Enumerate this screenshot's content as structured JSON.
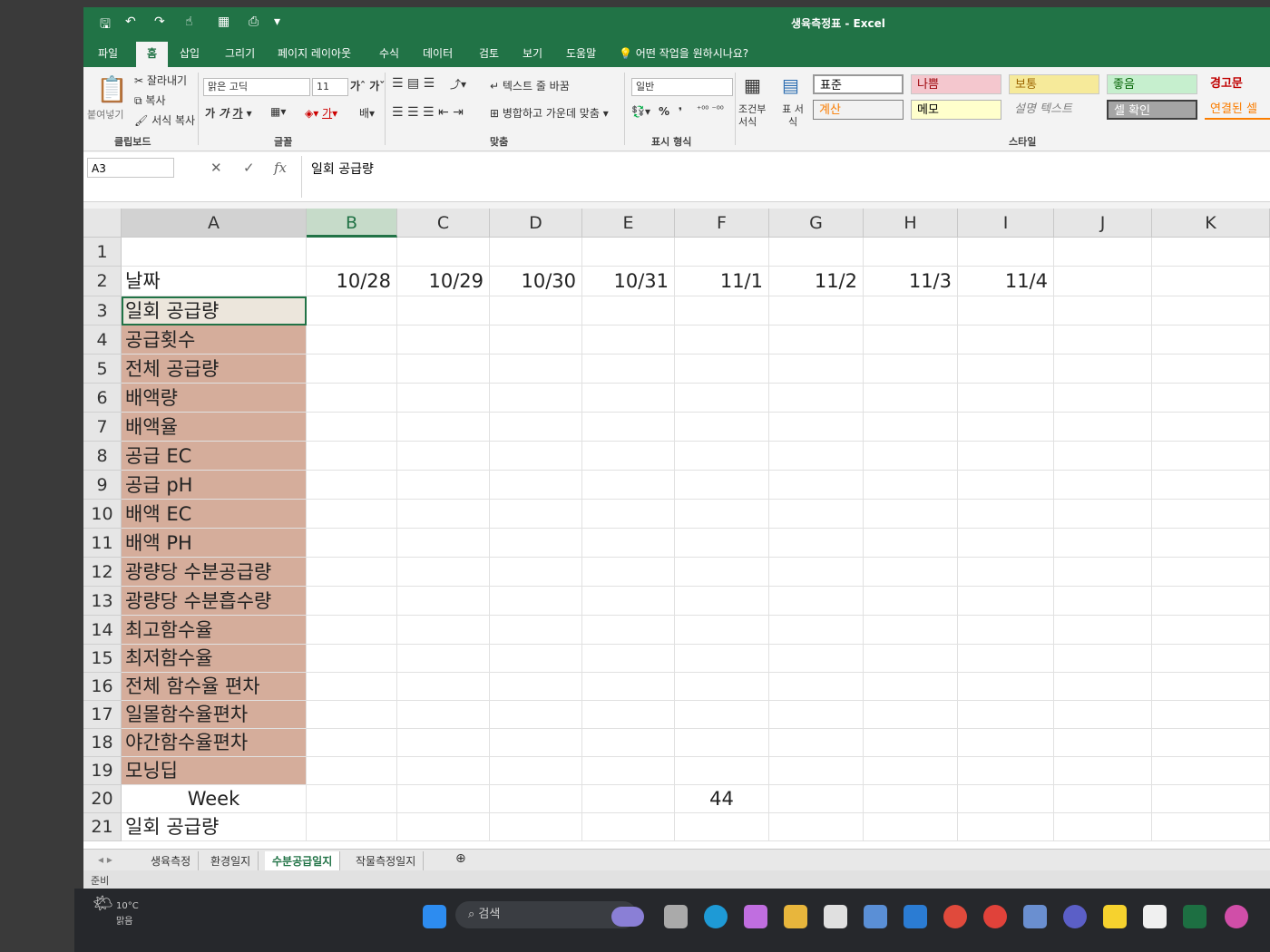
{
  "window": {
    "title": "생육측정표 - Excel"
  },
  "ribbon_tabs": [
    "파일",
    "홈",
    "삽입",
    "그리기",
    "페이지 레이아웃",
    "수식",
    "데이터",
    "검토",
    "보기",
    "도움말"
  ],
  "active_tab": "홈",
  "tell_me": "어떤 작업을 원하시나요?",
  "clipboard": {
    "paste": "붙여넣기",
    "cut": "잘라내기",
    "copy": "복사",
    "format_painter": "서식 복사",
    "group": "클립보드"
  },
  "font": {
    "name": "맑은 고딕",
    "size": "11",
    "group": "글꼴"
  },
  "alignment": {
    "wrap": "텍스트 줄 바꿈",
    "merge": "병합하고 가운데 맞춤",
    "group": "맞춤"
  },
  "number": {
    "format": "일반",
    "group": "표시 형식",
    "percent": "%"
  },
  "styles": {
    "conditional": "조건부 서식",
    "table": "표 서식",
    "items": [
      "표준",
      "나쁨",
      "보통",
      "좋음",
      "경고문",
      "계산",
      "메모",
      "설명 텍스트",
      "셀 확인",
      "연결된 셀"
    ],
    "group": "스타일"
  },
  "formula_bar": {
    "name_box": "A3",
    "content": "일회 공급량",
    "fx": "fx"
  },
  "columns": [
    "A",
    "B",
    "C",
    "D",
    "E",
    "F",
    "G",
    "H",
    "I",
    "J",
    "K"
  ],
  "rows": [
    "1",
    "2",
    "3",
    "4",
    "5",
    "6",
    "7",
    "8",
    "9",
    "10",
    "11",
    "12",
    "13",
    "14",
    "15",
    "16",
    "17",
    "18",
    "19",
    "20",
    "21"
  ],
  "cells": {
    "A2": "날짜",
    "dates": [
      "10/28",
      "10/29",
      "10/30",
      "10/31",
      "11/1",
      "11/2",
      "11/3",
      "11/4"
    ],
    "labels": [
      "일회 공급량",
      "공급횟수",
      "전체 공급량",
      "배액량",
      "배액율",
      "공급 EC",
      "공급 pH",
      "배액 EC",
      "배액 PH",
      "광량당 수분공급량",
      "광량당 수분흡수량",
      "최고함수율",
      "최저함수율",
      "전체 함수율 편차",
      "일몰함수율편차",
      "야간함수율편차",
      "모닝딥"
    ],
    "A20": "Week",
    "E20": "44",
    "A21": "일회 공급량"
  },
  "sheet_tabs": [
    "생육측정",
    "환경일지",
    "수분공급일지",
    "작물측정일지"
  ],
  "active_sheet": "수분공급일지",
  "status": "준비",
  "taskbar": {
    "weather_temp": "10°C",
    "weather_desc": "맑음",
    "search": "검색"
  }
}
